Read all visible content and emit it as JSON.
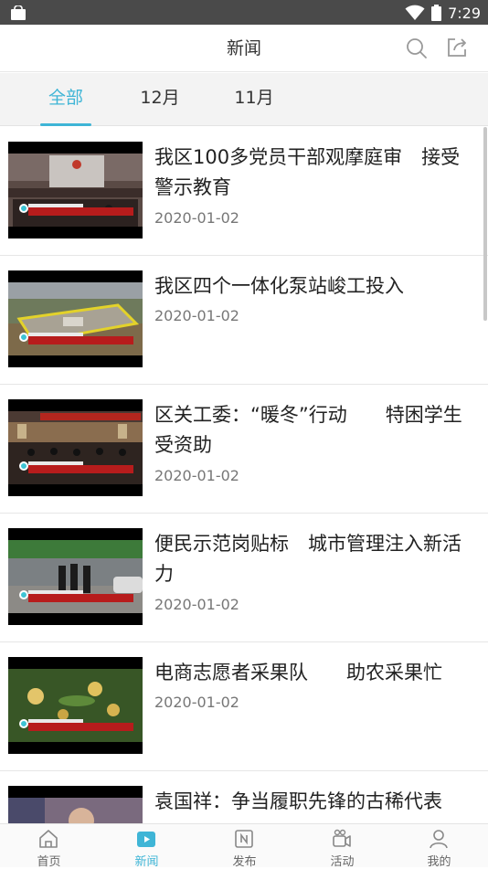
{
  "status_bar": {
    "time": "7:29"
  },
  "header": {
    "title": "新闻"
  },
  "tabs": [
    {
      "label": "全部",
      "active": true
    },
    {
      "label": "12月",
      "active": false
    },
    {
      "label": "11月",
      "active": false
    }
  ],
  "news": [
    {
      "title": "我区100多党员干部观摩庭审　接受警示教育",
      "date": "2020-01-02"
    },
    {
      "title": "我区四个一体化泵站峻工投入",
      "date": "2020-01-02"
    },
    {
      "title": "区关工委：“暖冬”行动　　特困学生受资助",
      "date": "2020-01-02"
    },
    {
      "title": "便民示范岗贴标　城市管理注入新活力",
      "date": "2020-01-02"
    },
    {
      "title": "电商志愿者采果队　　助农采果忙",
      "date": "2020-01-02"
    },
    {
      "title": "袁国祥：争当履职先锋的古稀代表",
      "date": ""
    }
  ],
  "bottom_nav": [
    {
      "label": "首页",
      "icon": "home-icon",
      "active": false
    },
    {
      "label": "新闻",
      "icon": "video-play-icon",
      "active": true
    },
    {
      "label": "发布",
      "icon": "publish-icon",
      "active": false
    },
    {
      "label": "活动",
      "icon": "camera-icon",
      "active": false
    },
    {
      "label": "我的",
      "icon": "user-icon",
      "active": false
    }
  ],
  "colors": {
    "accent": "#3fb5d6",
    "status_bar": "#4a4a4a",
    "tab_bg": "#f3f3f3"
  }
}
